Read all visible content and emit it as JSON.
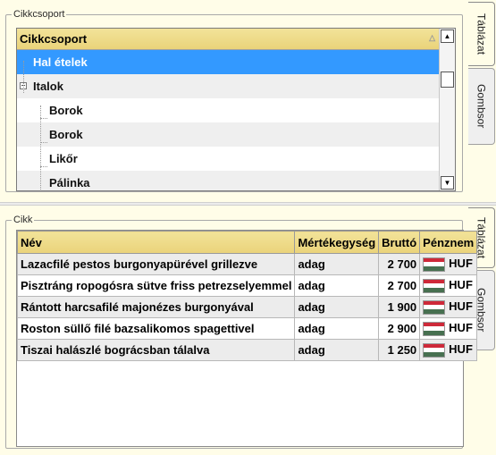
{
  "top": {
    "group_label": "Cikkcsoport",
    "tree_header": "Cikkcsoport",
    "tree_items": [
      {
        "label": "Hal ételek",
        "level": 0,
        "selected": true
      },
      {
        "label": "Italok",
        "level": 0,
        "expanded": true
      },
      {
        "label": "Borok",
        "level": 1
      },
      {
        "label": "Borok",
        "level": 1
      },
      {
        "label": "Likőr",
        "level": 1
      },
      {
        "label": "Pálinka",
        "level": 1
      }
    ],
    "tabs": [
      "Táblázat",
      "Gombsor"
    ]
  },
  "bottom": {
    "group_label": "Cikk",
    "columns": [
      "Név",
      "Mértékegység",
      "Bruttó",
      "Pénznem"
    ],
    "rows": [
      {
        "nev": "Lazacfilé pestos burgonyapürével grillezve",
        "mertek": "adag",
        "brutto": "2 700",
        "penznem": "HUF"
      },
      {
        "nev": "Pisztráng ropogósra sütve friss petrezselyemmel",
        "mertek": "adag",
        "brutto": "2 700",
        "penznem": "HUF"
      },
      {
        "nev": "Rántott harcsafilé majonézes burgonyával",
        "mertek": "adag",
        "brutto": "1 900",
        "penznem": "HUF"
      },
      {
        "nev": "Roston süllő filé bazsalikomos spagettivel",
        "mertek": "adag",
        "brutto": "2 900",
        "penznem": "HUF"
      },
      {
        "nev": "Tiszai halászlé bográcsban tálalva",
        "mertek": "adag",
        "brutto": "1 250",
        "penznem": "HUF"
      }
    ],
    "tabs": [
      "Táblázat",
      "Gombsor"
    ]
  },
  "colors": {
    "header": "#ead37a",
    "selection": "#3399ff",
    "flag": [
      "#ce2939",
      "#ffffff",
      "#477050"
    ]
  }
}
